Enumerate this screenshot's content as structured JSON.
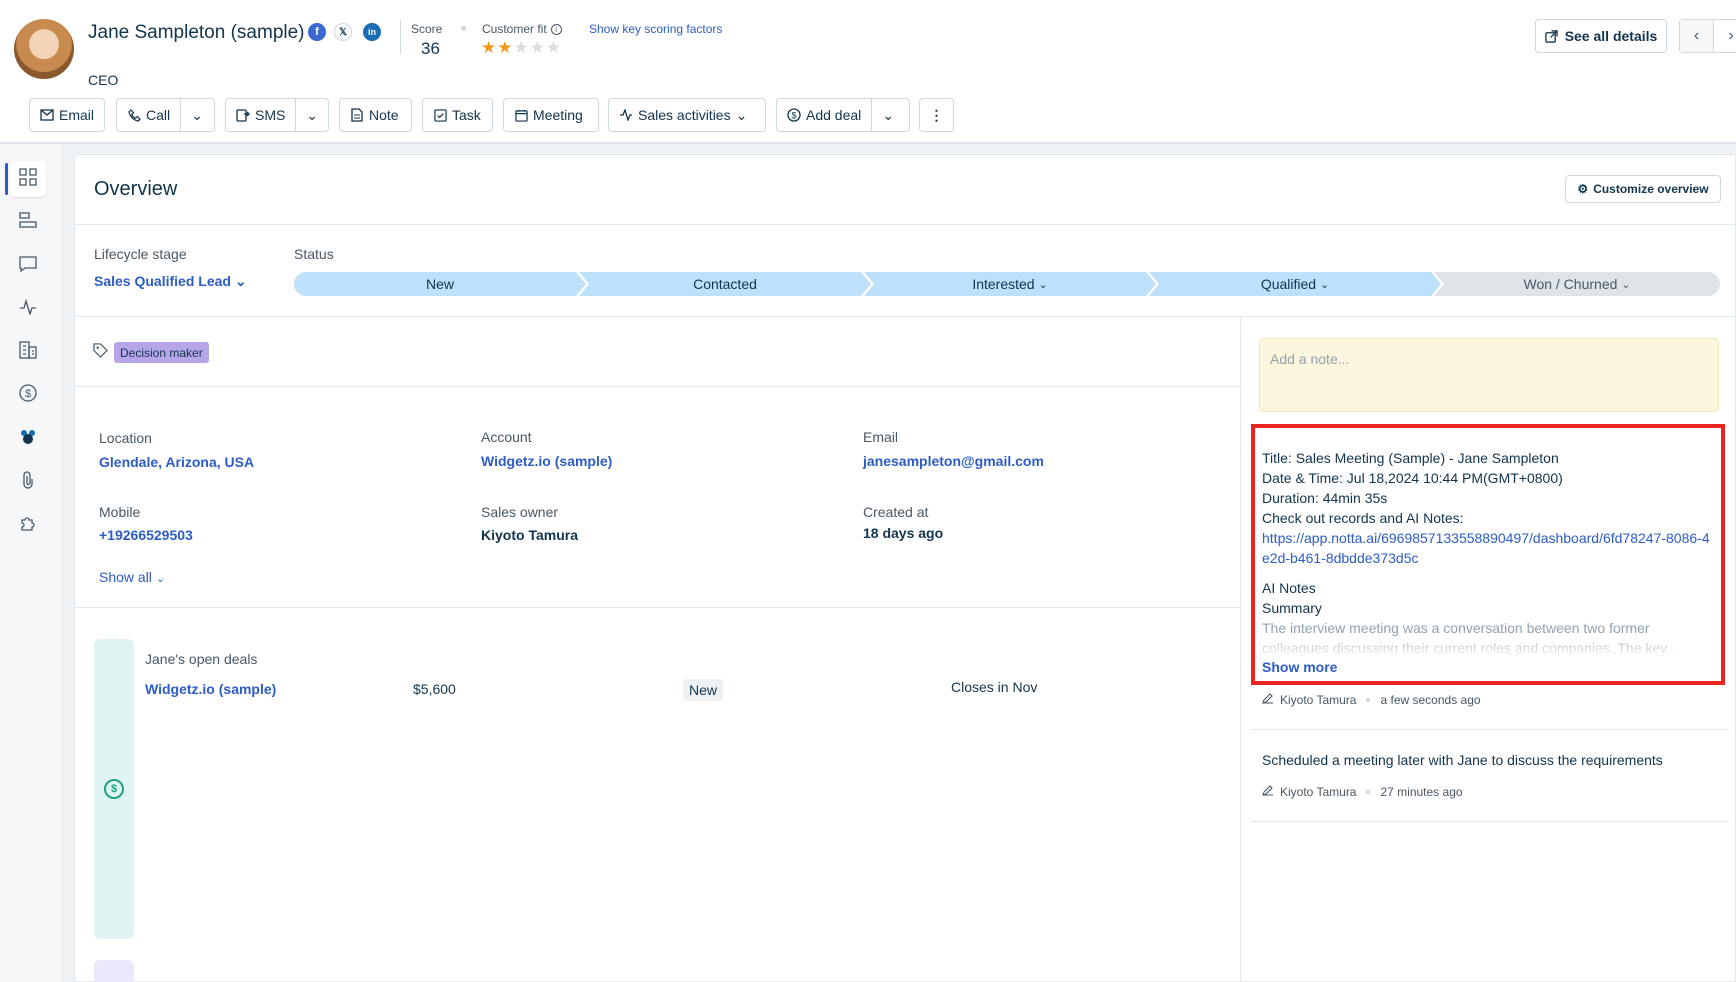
{
  "contact": {
    "name": "Jane Sampleton (sample)",
    "role": "CEO",
    "social": {
      "facebook": "f",
      "x": "𝕏",
      "linkedin": "in"
    },
    "score_label": "Score",
    "score": "36",
    "customer_fit_label": "Customer fit",
    "customer_fit_rating": 2,
    "customer_fit_max": 5,
    "scoring_link": "Show key scoring factors",
    "see_all_details": "See all details"
  },
  "toolbar": {
    "email": "Email",
    "call": "Call",
    "sms": "SMS",
    "note": "Note",
    "task": "Task",
    "meeting": "Meeting",
    "sales_activities": "Sales activities",
    "add_deal": "Add deal"
  },
  "sidebar": {
    "icons": [
      "overview-icon",
      "timeline-icon",
      "conversations-icon",
      "activities-icon",
      "accounts-icon",
      "deals-icon",
      "team-icon",
      "attachments-icon",
      "integrations-icon"
    ]
  },
  "overview": {
    "title": "Overview",
    "customize": "Customize overview",
    "lifecycle_label": "Lifecycle stage",
    "lifecycle_value": "Sales Qualified Lead",
    "status_label": "Status",
    "statuses": [
      "New",
      "Contacted",
      "Interested",
      "Qualified",
      "Won / Churned"
    ],
    "tag": "Decision maker"
  },
  "fields": {
    "location_label": "Location",
    "location": "Glendale, Arizona, USA",
    "account_label": "Account",
    "account": "Widgetz.io (sample)",
    "email_label": "Email",
    "email": "janesampleton@gmail.com",
    "mobile_label": "Mobile",
    "mobile": "+19266529503",
    "owner_label": "Sales owner",
    "owner": "Kiyoto Tamura",
    "created_label": "Created at",
    "created": "18 days ago",
    "show_all": "Show all"
  },
  "deals": {
    "heading": "Jane's open deals",
    "name": "Widgetz.io (sample)",
    "amount": "$5,600",
    "stage": "New",
    "close": "Closes in Nov"
  },
  "notes": {
    "placeholder": "Add a note...",
    "note1": {
      "title": "Title: Sales Meeting (Sample) - Jane Sampleton",
      "datetime": "Date & Time: Jul 18,2024 10:44 PM(GMT+0800)",
      "duration": "Duration: 44min 35s",
      "records": "Check out records and AI Notes:",
      "url": "https://app.notta.ai/6969857133558890497/dashboard/6fd78247-8086-4e2d-b461-8dbdde373d5c",
      "ai_notes": "AI Notes",
      "summary": "Summary",
      "summary_text": "The interview meeting was a conversation between two former colleagues discussing their current roles and companies. The key...",
      "show_more": "Show more",
      "author": "Kiyoto Tamura",
      "time": "a few seconds ago"
    },
    "note2": {
      "text": "Scheduled a meeting later with Jane to discuss the requirements",
      "author": "Kiyoto Tamura",
      "time": "27 minutes ago"
    }
  },
  "colors": {
    "accent": "#2c5cc5",
    "highlight": "#e8251e",
    "stage": "#bde0fb"
  }
}
